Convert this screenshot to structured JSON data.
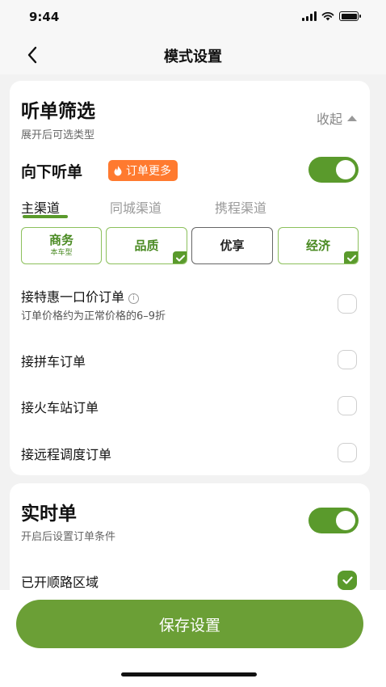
{
  "status_bar": {
    "time": "9:44"
  },
  "header": {
    "title": "模式设置"
  },
  "filter_section": {
    "title": "听单筛选",
    "subtitle": "展开后可选类型",
    "collapse_label": "收起",
    "downward": {
      "label": "向下听单",
      "badge": "订单更多",
      "toggle_on": true
    },
    "tabs": [
      {
        "label": "主渠道",
        "active": true
      },
      {
        "label": "同城渠道",
        "active": false
      },
      {
        "label": "携程渠道",
        "active": false
      }
    ],
    "types": [
      {
        "name": "商务",
        "sub": "本车型",
        "selected": true,
        "checked": false
      },
      {
        "name": "品质",
        "sub": "",
        "selected": true,
        "checked": true
      },
      {
        "name": "优享",
        "sub": "",
        "selected": false,
        "checked": false
      },
      {
        "name": "经济",
        "sub": "",
        "selected": true,
        "checked": true
      }
    ],
    "options": [
      {
        "label": "接特惠一口价订单",
        "sub": "订单价格约为正常价格的6–9折",
        "checked": false,
        "info_icon": "i"
      },
      {
        "label": "接拼车订单",
        "checked": false
      },
      {
        "label": "接火车站订单",
        "checked": false
      },
      {
        "label": "接远程调度订单",
        "checked": false
      }
    ]
  },
  "realtime_section": {
    "title": "实时单",
    "subtitle": "开启后设置订单条件",
    "toggle_on": true,
    "route_area": {
      "label": "已开顺路区域",
      "checked": true
    }
  },
  "footer": {
    "save_label": "保存设置"
  },
  "colors": {
    "accent": "#5a9a2c",
    "badge": "#ff7a2f",
    "save_button": "#6b9f36"
  },
  "icons": [
    "back-arrow-icon",
    "flame-icon",
    "info-icon",
    "chevron-up-icon",
    "check-icon",
    "signal-icon",
    "wifi-icon",
    "battery-icon"
  ]
}
